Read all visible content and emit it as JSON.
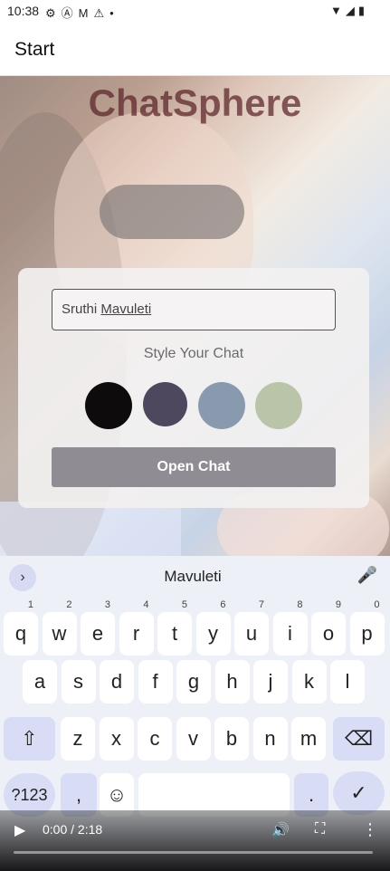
{
  "status_bar": {
    "time": "10:38",
    "left_icons": [
      "gear-icon",
      "a-icon",
      "gmail-icon",
      "alert-icon",
      "dot-icon"
    ],
    "right_icons": [
      "wifi-icon",
      "signal-icon",
      "battery-icon"
    ]
  },
  "app_bar": {
    "title": "Start"
  },
  "brand": {
    "name": "ChatSphere"
  },
  "card": {
    "name_value_first": "Sruthi",
    "name_value_last": "Mavuleti",
    "style_label": "Style Your Chat",
    "swatches": [
      {
        "name": "black",
        "color": "#0d0b0c"
      },
      {
        "name": "slate-purple",
        "color": "#4e485e"
      },
      {
        "name": "steel-blue",
        "color": "#8a9aae"
      },
      {
        "name": "sage",
        "color": "#b9c4a8"
      }
    ],
    "open_chat_label": "Open Chat"
  },
  "keyboard": {
    "suggestion": "Mavuleti",
    "row1": [
      [
        "q",
        "1"
      ],
      [
        "w",
        "2"
      ],
      [
        "e",
        "3"
      ],
      [
        "r",
        "4"
      ],
      [
        "t",
        "5"
      ],
      [
        "y",
        "6"
      ],
      [
        "u",
        "7"
      ],
      [
        "i",
        "8"
      ],
      [
        "o",
        "9"
      ],
      [
        "p",
        "0"
      ]
    ],
    "row2": [
      "a",
      "s",
      "d",
      "f",
      "g",
      "h",
      "j",
      "k",
      "l"
    ],
    "row3": [
      "z",
      "x",
      "c",
      "v",
      "b",
      "n",
      "m"
    ],
    "symbols_label": "?123",
    "comma": ",",
    "period": ".",
    "emoji_glyph": "☺",
    "shift_glyph": "⇧",
    "backspace_glyph": "⌫",
    "enter_glyph": "✓",
    "chevron_glyph": "›",
    "mic_glyph": "🎤"
  },
  "video": {
    "time": "0:00 / 2:18",
    "progress": 0.0
  }
}
